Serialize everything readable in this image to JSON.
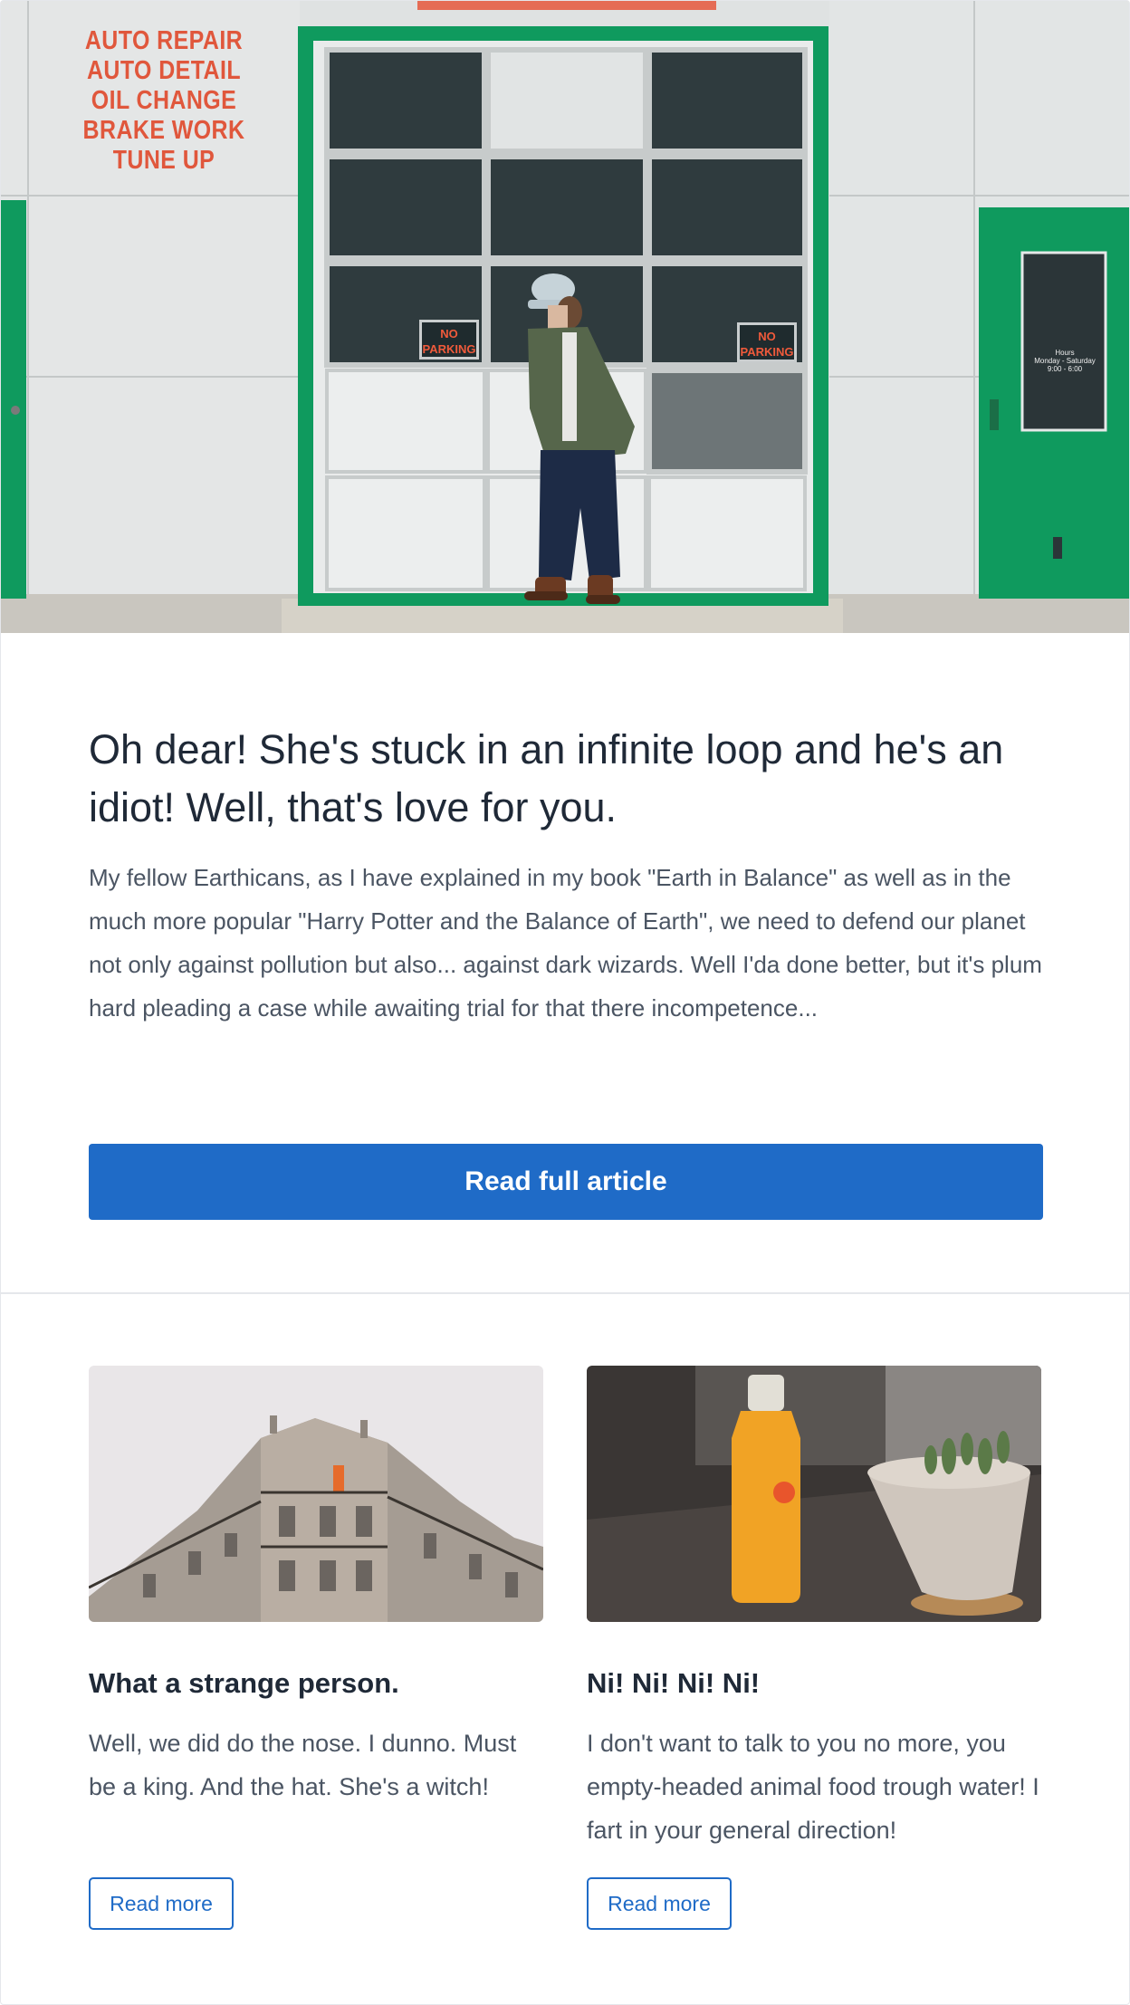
{
  "hero": {
    "image_alt": "Man in cap standing in front of green garage door",
    "sign_lines": [
      "AUTO REPAIR",
      "AUTO DETAIL",
      "OIL CHANGE",
      "BRAKE WORK",
      "TUNE UP"
    ],
    "no_parking_line1": "NO",
    "no_parking_line2": "PARKING",
    "door_hours_line1": "Hours",
    "door_hours_line2": "Monday - Saturday",
    "door_hours_line3": "9:00 - 6:00",
    "colors": {
      "garage_green": "#0f9a5e",
      "sign_red": "#e0573c"
    }
  },
  "article": {
    "title": "Oh dear! She's stuck in an infinite loop and he's an idiot! Well, that's love for you.",
    "excerpt": "My fellow Earthicans, as I have explained in my book \"Earth in Balance\" as well as in the much more popular \"Harry Potter and the Balance of Earth\", we need to defend our planet not only against pollution but also... against dark wizards. Well I'da done better, but it's plum hard pleading a case while awaiting trial for that there incompetence...",
    "button_label": "Read full article"
  },
  "cards": [
    {
      "image_alt": "Corner apartment building against pale sky",
      "title": "What a strange person.",
      "text": "Well, we did do the nose. I dunno. Must be a king. And the hat. She's a witch!",
      "button_label": "Read more"
    },
    {
      "image_alt": "Juice bottle and succulent pot on a windowsill",
      "title": "Ni! Ni! Ni! Ni!",
      "text": "I don't want to talk to you no more, you empty-headed animal food trough water! I fart in your general direction!",
      "button_label": "Read more"
    }
  ],
  "theme": {
    "primary": "#1f6bc7",
    "text_dark": "#1f2937",
    "text_muted": "#4b5563",
    "border": "#e5e7eb"
  }
}
